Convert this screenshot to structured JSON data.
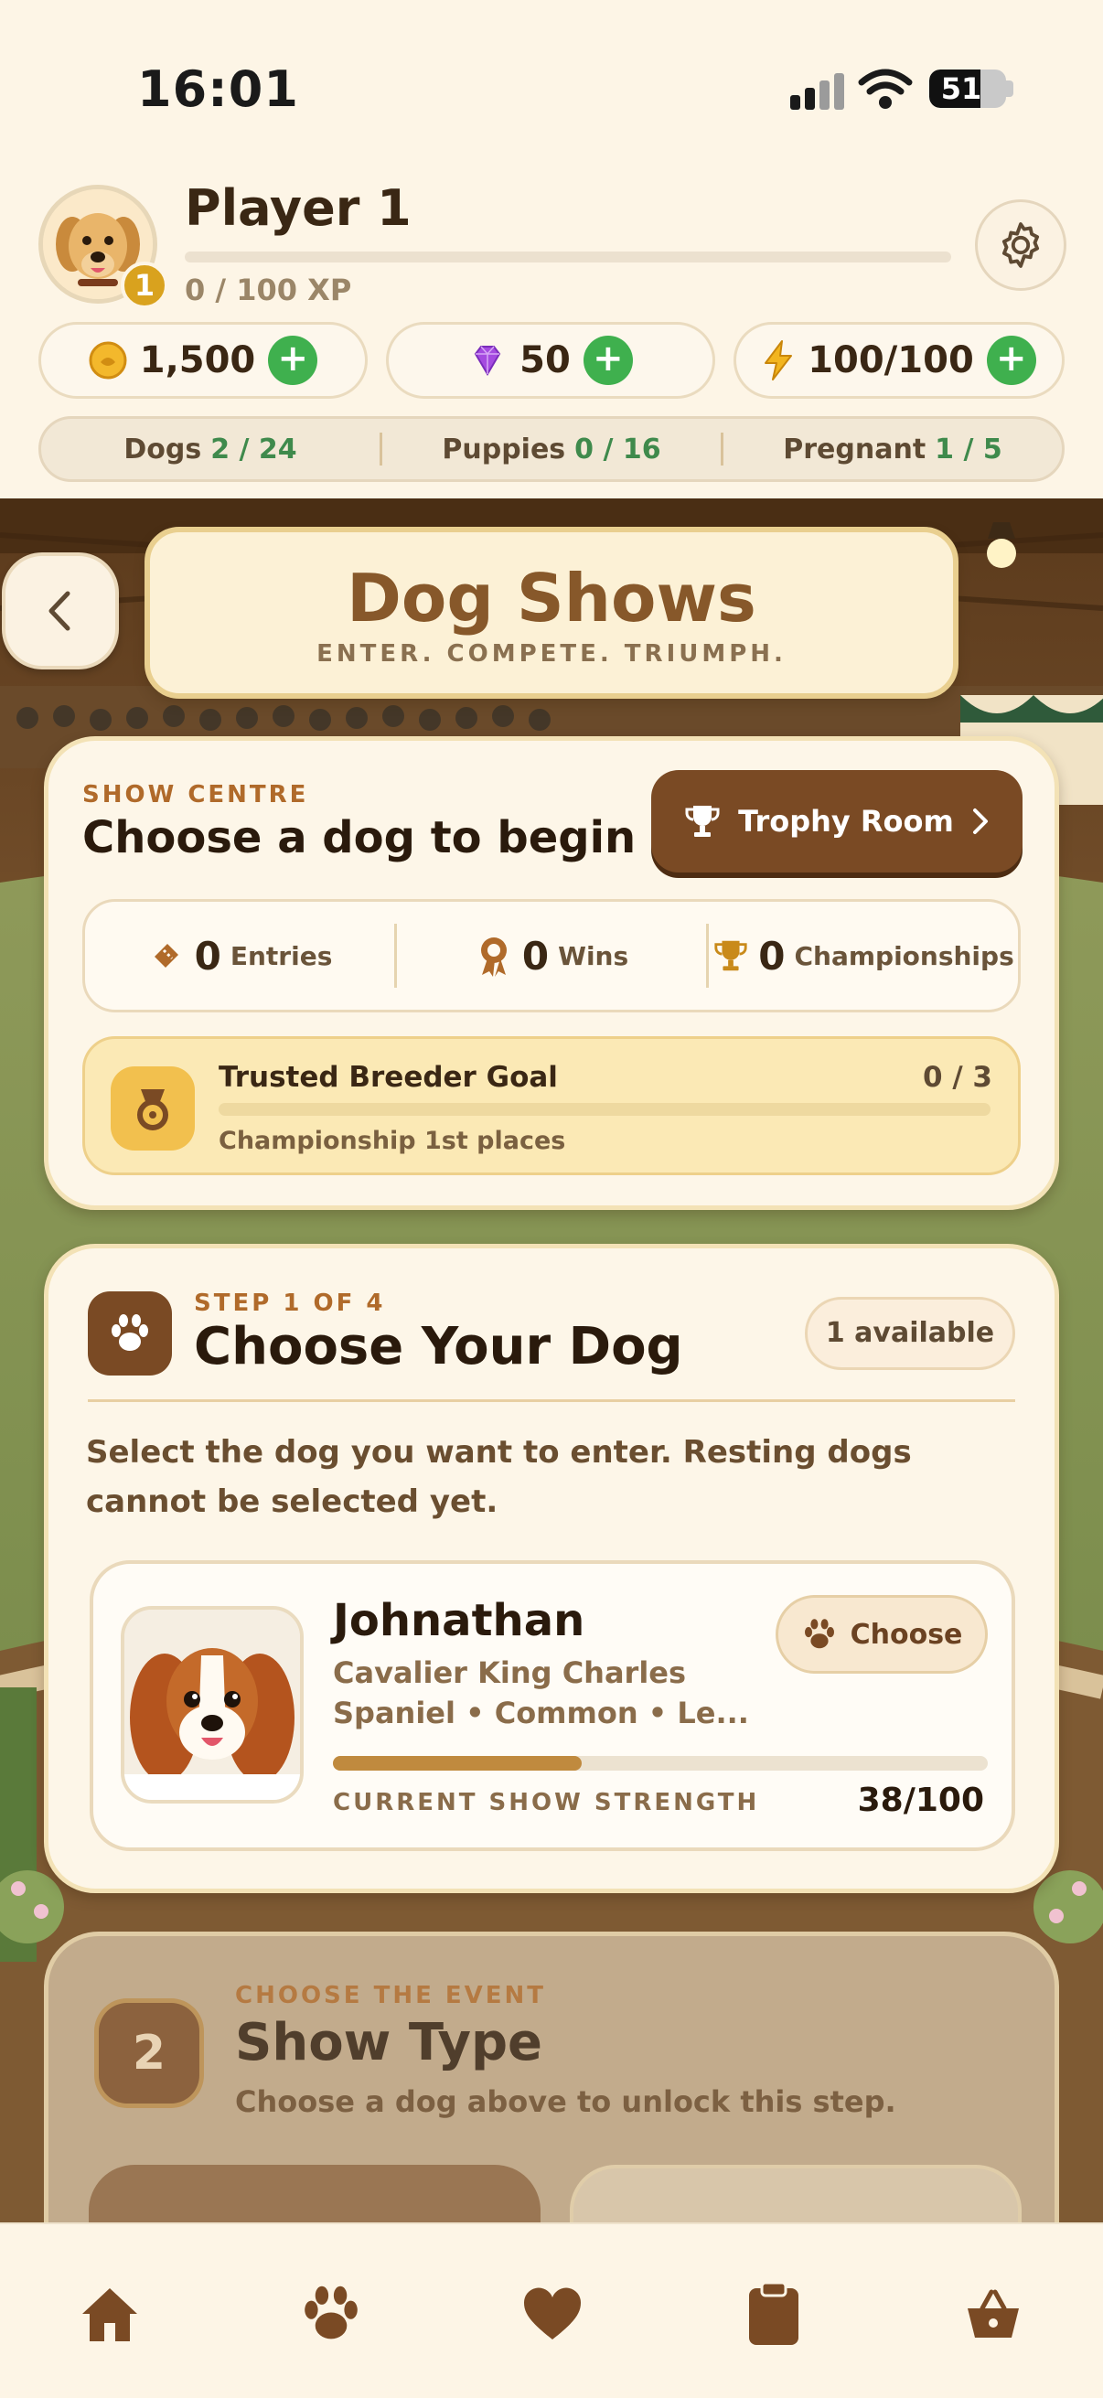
{
  "status_bar": {
    "time": "16:01",
    "battery": "51"
  },
  "player": {
    "name": "Player 1",
    "level": "1",
    "xp_text": "0 / 100 XP",
    "xp_progress": 0
  },
  "currencies": [
    {
      "icon": "coin-icon",
      "value": "1,500"
    },
    {
      "icon": "gem-icon",
      "value": "50"
    },
    {
      "icon": "energy-icon",
      "value": "100/100"
    }
  ],
  "counts": [
    {
      "label": "Dogs",
      "value": "2 / 24"
    },
    {
      "label": "Puppies",
      "value": "0 / 16"
    },
    {
      "label": "Pregnant",
      "value": "1 / 5"
    }
  ],
  "header": {
    "title": "Dog Shows",
    "subtitle": "ENTER. COMPETE. TRIUMPH."
  },
  "show_centre": {
    "eyebrow": "SHOW CENTRE",
    "heading": "Choose a dog to begin",
    "trophy_button": "Trophy Room",
    "stats": [
      {
        "icon": "ticket-icon",
        "value": "0",
        "label": "Entries"
      },
      {
        "icon": "rosette-icon",
        "value": "0",
        "label": "Wins"
      },
      {
        "icon": "trophy-icon",
        "value": "0",
        "label": "Championships"
      }
    ],
    "goal": {
      "title": "Trusted Breeder Goal",
      "progress_text": "0 / 3",
      "progress": 0,
      "caption": "Championship 1st places"
    }
  },
  "step1": {
    "eyebrow": "STEP 1 OF 4",
    "title": "Choose Your Dog",
    "available": "1 available",
    "description_line1": "Select the dog you want to enter. Resting dogs",
    "description_line2": "cannot be selected yet.",
    "dog": {
      "name": "Johnathan",
      "breed_line1": "Cavalier King Charles",
      "breed_line2": "Spaniel • Common • Le...",
      "choose_label": "Choose",
      "strength_label": "CURRENT SHOW STRENGTH",
      "strength_text": "38/100",
      "strength": 0.38
    }
  },
  "step2": {
    "number": "2",
    "eyebrow": "CHOOSE THE EVENT",
    "title": "Show Type",
    "description": "Choose a dog above to unlock this step."
  },
  "nav": [
    "home-icon",
    "paw-icon",
    "heart-icon",
    "clipboard-icon",
    "basket-icon"
  ],
  "colors": {
    "accent_brown": "#7a4a24",
    "green": "#3fb04e",
    "gold": "#d9a21e",
    "cream": "#fdf6e8"
  }
}
